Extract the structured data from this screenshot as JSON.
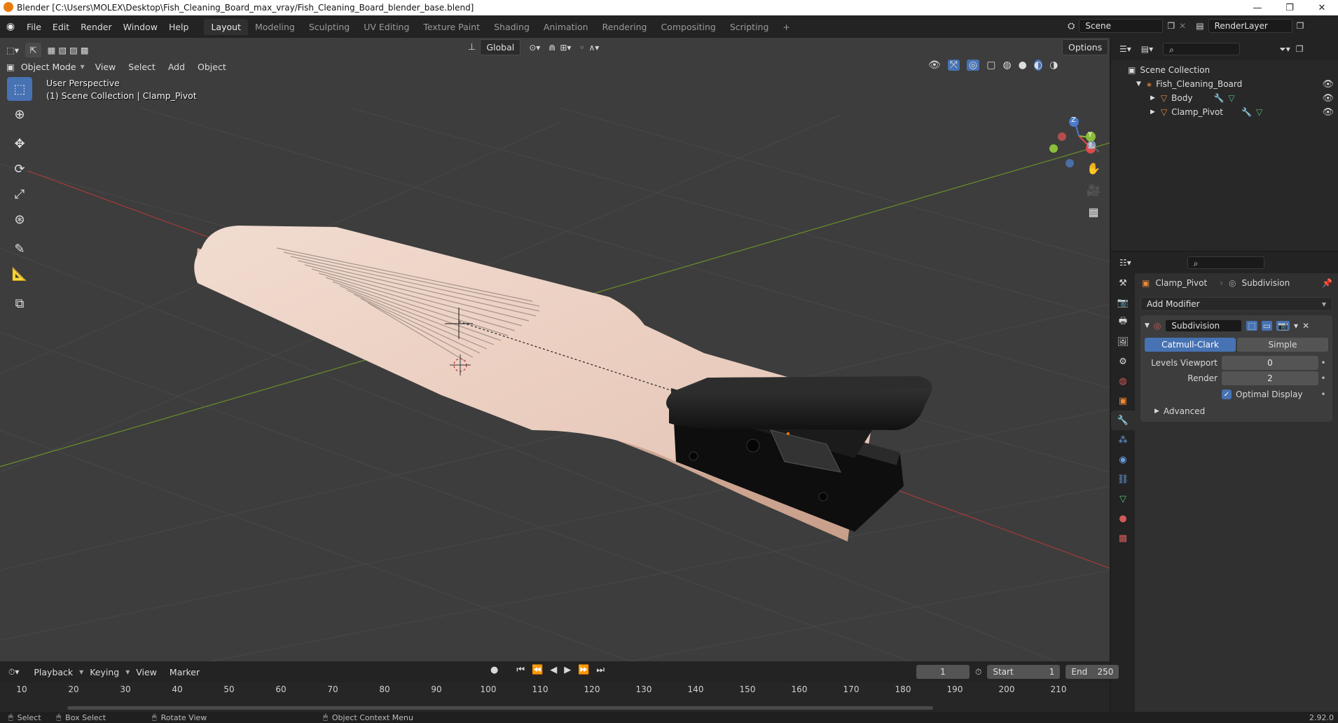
{
  "window": {
    "title": "Blender [C:\\Users\\MOLEX\\Desktop\\Fish_Cleaning_Board_max_vray/Fish_Cleaning_Board_blender_base.blend]",
    "minimize": "—",
    "restore": "❐",
    "close": "✕"
  },
  "topbar": {
    "menus": [
      "File",
      "Edit",
      "Render",
      "Window",
      "Help"
    ],
    "workspaces": [
      "Layout",
      "Modeling",
      "Sculpting",
      "UV Editing",
      "Texture Paint",
      "Shading",
      "Animation",
      "Rendering",
      "Compositing",
      "Scripting"
    ],
    "active_workspace": "Layout",
    "add_tab": "+",
    "scene": "Scene",
    "render_layer": "RenderLayer"
  },
  "viewport": {
    "mode": "Object Mode",
    "menus": [
      "View",
      "Select",
      "Add",
      "Object"
    ],
    "transform_orientation": "Global",
    "options_label": "Options",
    "overlay_line1": "User Perspective",
    "overlay_line2": "(1) Scene Collection | Clamp_Pivot",
    "gizmo": {
      "x": "X",
      "y": "Y",
      "z": "Z"
    }
  },
  "outliner": {
    "root": "Scene Collection",
    "items": [
      {
        "label": "Fish_Cleaning_Board",
        "level": 1
      },
      {
        "label": "Body",
        "level": 2
      },
      {
        "label": "Clamp_Pivot",
        "level": 2
      }
    ]
  },
  "properties": {
    "breadcrumb_object": "Clamp_Pivot",
    "breadcrumb_modifier": "Subdivision",
    "add_modifier": "Add Modifier",
    "modifier": {
      "name": "Subdivision",
      "types": [
        "Catmull-Clark",
        "Simple"
      ],
      "active_type": "Catmull-Clark",
      "levels_viewport_label": "Levels Viewport",
      "levels_viewport": "0",
      "render_label": "Render",
      "render": "2",
      "optimal_display_label": "Optimal Display",
      "optimal_display": true,
      "advanced_label": "Advanced"
    }
  },
  "timeline": {
    "menus": [
      "Playback",
      "Keying",
      "View",
      "Marker"
    ],
    "current_frame": "1",
    "start_label": "Start",
    "start": "1",
    "end_label": "End",
    "end": "250",
    "ticks": [
      "10",
      "20",
      "30",
      "40",
      "50",
      "60",
      "70",
      "80",
      "90",
      "100",
      "110",
      "120",
      "130",
      "140",
      "150",
      "160",
      "170",
      "180",
      "190",
      "200",
      "210"
    ]
  },
  "statusbar": {
    "items": [
      "Select",
      "Box Select",
      "Rotate View",
      "Object Context Menu"
    ],
    "version": "2.92.0"
  },
  "colors": {
    "accent": "#4772b3",
    "grid_bg": "#3d3d3d",
    "axis_x": "#a33a3a",
    "axis_y": "#6a8f2a",
    "wood": "#e9cfc0",
    "clamp": "#161616"
  }
}
